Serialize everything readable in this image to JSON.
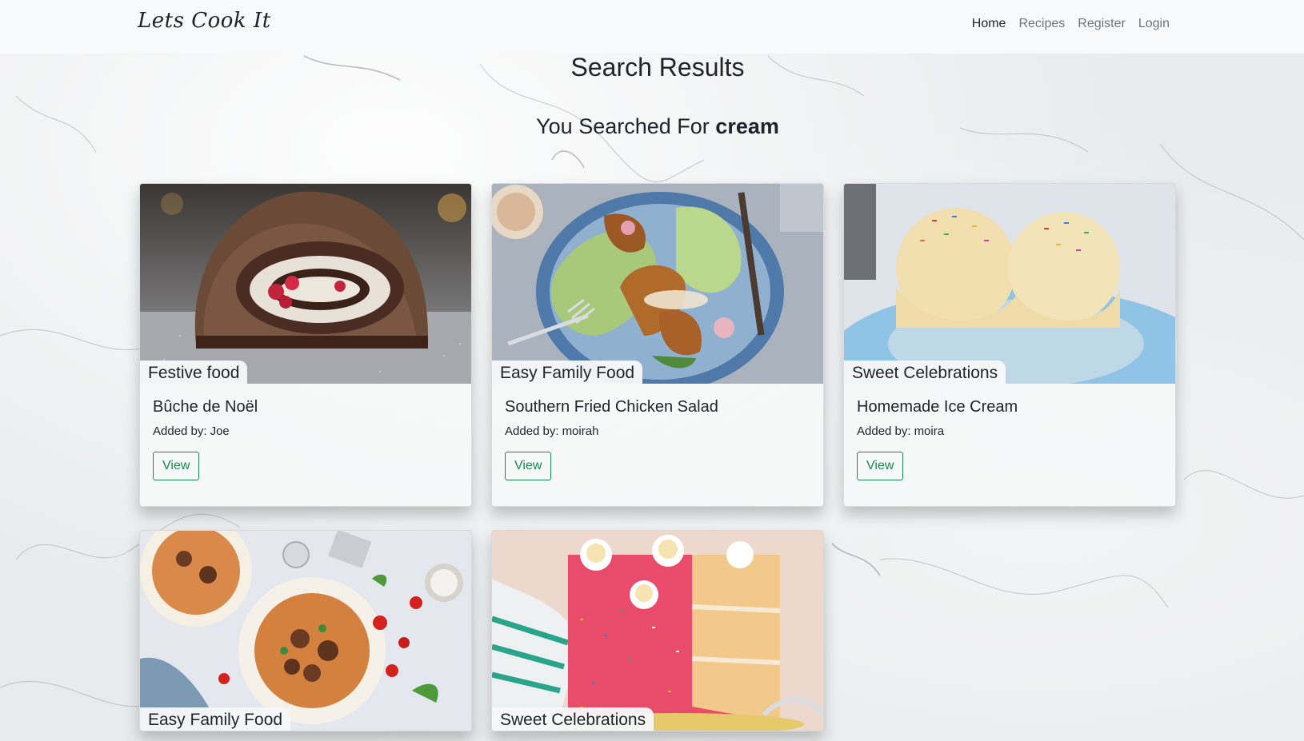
{
  "navbar": {
    "brand": "Lets Cook It",
    "links": [
      "Home",
      "Recipes",
      "Register",
      "Login"
    ]
  },
  "page": {
    "title": "Search Results",
    "searched_prefix": "You Searched For",
    "query": "cream"
  },
  "cards": [
    {
      "category": "Festive food",
      "name": "Bûche de Noël",
      "added_label": "Added by:",
      "author": "Joe",
      "button": "View",
      "image": "yule-log-cake"
    },
    {
      "category": "Easy Family Food",
      "name": "Southern Fried Chicken Salad",
      "added_label": "Added by:",
      "author": "moirah",
      "button": "View",
      "image": "fried-chicken-salad"
    },
    {
      "category": "Sweet Celebrations",
      "name": "Homemade Ice Cream",
      "added_label": "Added by:",
      "author": "moira",
      "button": "View",
      "image": "ice-cream-scoops"
    },
    {
      "category": "Easy Family Food",
      "name": "",
      "added_label": "",
      "author": "",
      "button": "",
      "image": "spaghetti-meatballs"
    },
    {
      "category": "Sweet Celebrations",
      "name": "",
      "added_label": "",
      "author": "",
      "button": "",
      "image": "sprinkle-cake"
    }
  ]
}
